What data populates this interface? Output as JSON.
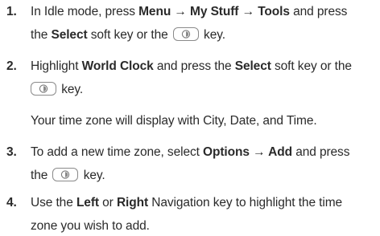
{
  "steps": [
    {
      "number": "1.",
      "line1": {
        "t1": "In Idle mode, press ",
        "b1": "Menu",
        "arrow1": " → ",
        "b2": "My Stuff",
        "arrow2": " → ",
        "b3": "Tools",
        "t2": " and press"
      },
      "line2": {
        "t1": "the ",
        "b1": "Select",
        "t2": " soft key or the",
        "t3": "key."
      }
    },
    {
      "number": "2.",
      "line1": {
        "t1": "Highlight ",
        "b1": "World Clock",
        "t2": " and press the ",
        "b2": "Select",
        "t3": " soft key or the"
      },
      "line2": {
        "t1": "key."
      },
      "note": "Your time zone will display with City, Date, and Time."
    },
    {
      "number": "3.",
      "line1": {
        "t1": "To add a new time zone, select ",
        "b1": "Options",
        "arrow1": " → ",
        "b2": "Add",
        "t2": " and press"
      },
      "line2": {
        "t1": "the",
        "t2": "key."
      }
    },
    {
      "number": "4.",
      "line1": {
        "t1": "Use the ",
        "b1": "Left",
        "t2": " or ",
        "b2": "Right",
        "t3": " Navigation key to highlight the time"
      },
      "line2": {
        "t1": "zone you wish to add."
      }
    }
  ],
  "icons": {
    "ok_key": "center-select-key-icon"
  }
}
